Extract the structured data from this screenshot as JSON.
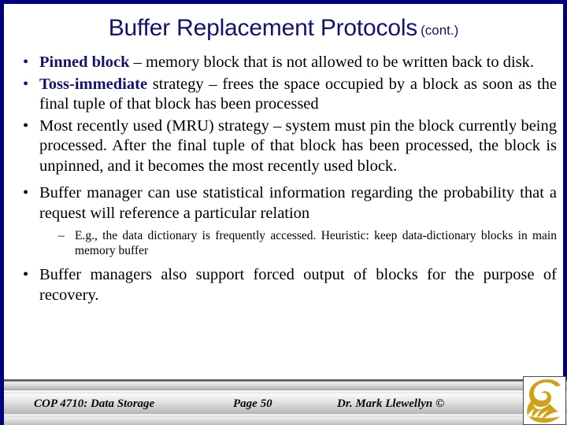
{
  "slide": {
    "title_main": "Buffer Replacement Protocols",
    "title_suffix": "(cont.)",
    "accent_navy": "#11136e",
    "border_color": "#000080",
    "background": "#ffffff"
  },
  "bullets": [
    {
      "marker": "•",
      "marker_color": "#11136e",
      "lead": "Pinned block",
      "rest": " – memory block that is not allowed to be written back to disk."
    },
    {
      "marker": "•",
      "marker_color": "#11136e",
      "lead": "Toss-immediate",
      "rest": " strategy – frees the space occupied by a block as soon as the final tuple of that block has been processed"
    },
    {
      "marker": "•",
      "marker_color": "#000000",
      "lead": "",
      "rest": "Most recently used (MRU) strategy –  system must pin the block currently being processed.  After the final tuple of that block has been processed, the block is unpinned, and it becomes the most recently used block."
    },
    {
      "marker": "•",
      "marker_color": "#000000",
      "lead": "",
      "rest": "Buffer manager can use statistical information regarding the probability that a request will reference a particular relation"
    },
    {
      "marker": "•",
      "marker_color": "#000000",
      "lead": "",
      "rest": "Buffer managers also support forced output of blocks for the purpose of recovery."
    }
  ],
  "subbullet": {
    "marker": "–",
    "text": "E.g., the data dictionary is frequently accessed.   Heuristic:  keep data-dictionary blocks in main memory buffer"
  },
  "footer": {
    "course": "COP 4710: Data Storage",
    "page": "Page 50",
    "author": "Dr. Mark Llewellyn ©",
    "logo_name": "ucf-pegasus-logo",
    "logo_color": "#d1a117"
  }
}
